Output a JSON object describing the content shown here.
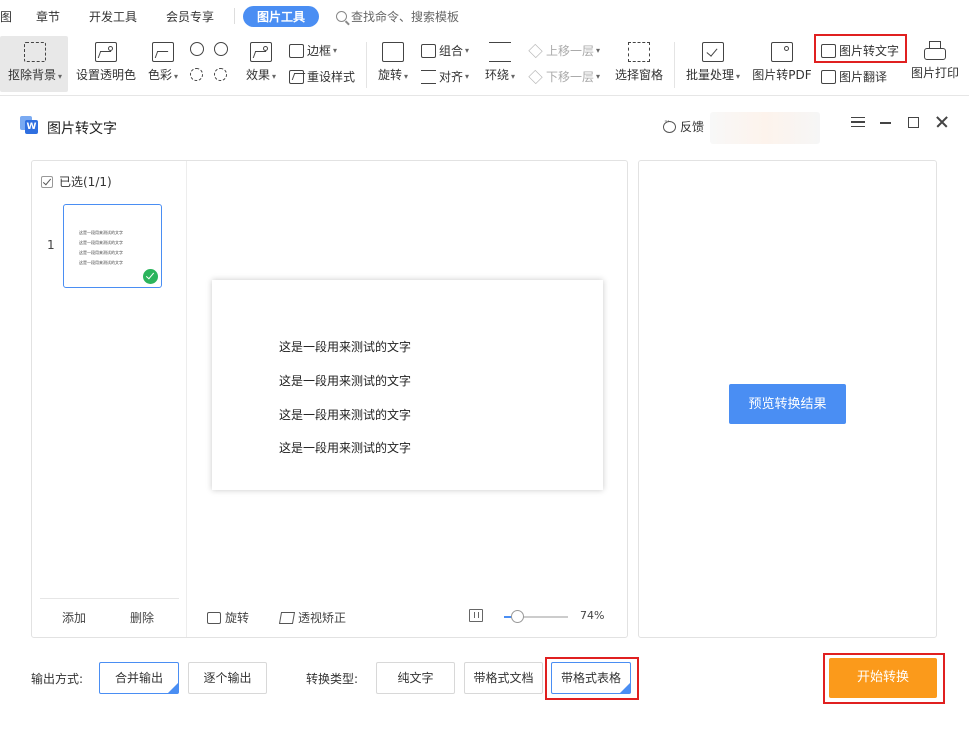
{
  "menu": {
    "tabs": [
      {
        "label": "图",
        "active": false
      },
      {
        "label": "章节",
        "active": false
      },
      {
        "label": "开发工具",
        "active": false
      },
      {
        "label": "会员专享",
        "active": false
      },
      {
        "label": "图片工具",
        "active": true
      }
    ],
    "search_label": "查找命令、搜索模板"
  },
  "ribbon": {
    "remove_bg": "抠除背景",
    "transparency": "设置透明色",
    "color": "色彩",
    "effects": "效果",
    "border": "边框",
    "reset_style": "重设样式",
    "rotate": "旋转",
    "group": "组合",
    "align": "对齐",
    "wrap": "环绕",
    "bring_forward": "上移一层",
    "send_backward": "下移一层",
    "selection_pane": "选择窗格",
    "batch": "批量处理",
    "to_pdf": "图片转PDF",
    "to_text": "图片转文字",
    "translate": "图片翻译",
    "print": "图片打印"
  },
  "dialog": {
    "title": "图片转文字",
    "feedback": "反馈"
  },
  "left_panel": {
    "selected_label": "已选(1/1)",
    "thumb_number": "1",
    "add_label": "添加",
    "delete_label": "删除",
    "rotate_label": "旋转",
    "perspective_label": "透视矫正",
    "zoom_value": "74%",
    "zoom_fraction": 0.2
  },
  "preview_lines": [
    "这是一段用来测试的文字",
    "这是一段用来测试的文字",
    "这是一段用来测试的文字",
    "这是一段用来测试的文字"
  ],
  "right_panel": {
    "preview_button": "预览转换结果"
  },
  "options": {
    "output_label": "输出方式:",
    "merge_output": "合并输出",
    "each_output": "逐个输出",
    "type_label": "转换类型:",
    "plain_text": "纯文字",
    "formatted_doc": "带格式文档",
    "formatted_table": "带格式表格",
    "start_button": "开始转换"
  }
}
